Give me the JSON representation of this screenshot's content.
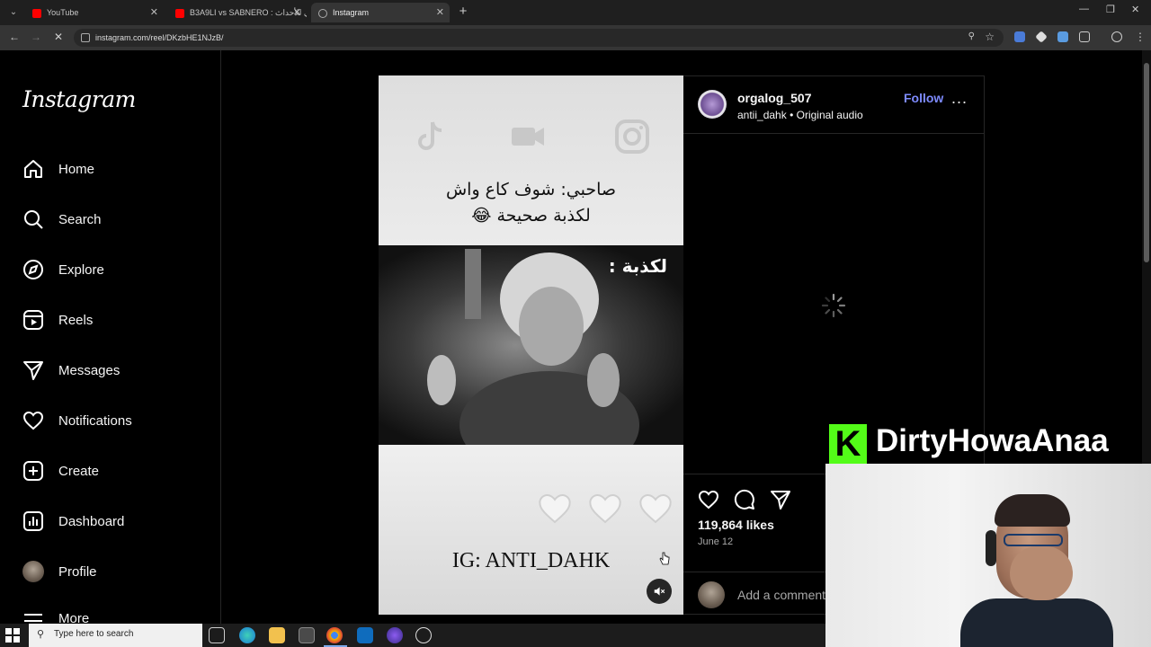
{
  "browser": {
    "tabs": [
      {
        "title": "YouTube",
        "active": false
      },
      {
        "title": "B3A9LI vs SABNERO : تحدي للأحداث",
        "active": false
      },
      {
        "title": "Instagram",
        "active": true
      }
    ],
    "url": "instagram.com/reel/DKzbHE1NJzB/"
  },
  "sidebar": {
    "logo": "Instagram",
    "items": [
      {
        "label": "Home",
        "icon": "home-icon"
      },
      {
        "label": "Search",
        "icon": "search-icon"
      },
      {
        "label": "Explore",
        "icon": "compass-icon"
      },
      {
        "label": "Reels",
        "icon": "reels-icon"
      },
      {
        "label": "Messages",
        "icon": "paper-plane-icon"
      },
      {
        "label": "Notifications",
        "icon": "heart-icon"
      },
      {
        "label": "Create",
        "icon": "plus-square-icon"
      },
      {
        "label": "Dashboard",
        "icon": "bar-chart-icon"
      },
      {
        "label": "Profile",
        "icon": "profile-avatar"
      },
      {
        "label": "More",
        "icon": "hamburger-icon"
      }
    ]
  },
  "post": {
    "username": "orgalog_507",
    "audio_author": "antii_dahk",
    "audio_separator": "•",
    "audio_label": "Original audio",
    "follow_label": "Follow",
    "more_label": "...",
    "likes": "119,864 likes",
    "date": "June 12",
    "comment_placeholder": "Add a comment..."
  },
  "reel": {
    "caption_line1": "صاحبي: شوف كاع واش",
    "caption_line2": "لكذبة صحيحة 😂",
    "lie_label": "لكذبة :",
    "watermark": "IG: ANTI_DAHK"
  },
  "overlay": {
    "platform_letter": "K",
    "streamer_name": "DirtyHowaAnaa",
    "brand_color": "#53fc18"
  },
  "taskbar": {
    "search_placeholder": "Type here to search"
  }
}
